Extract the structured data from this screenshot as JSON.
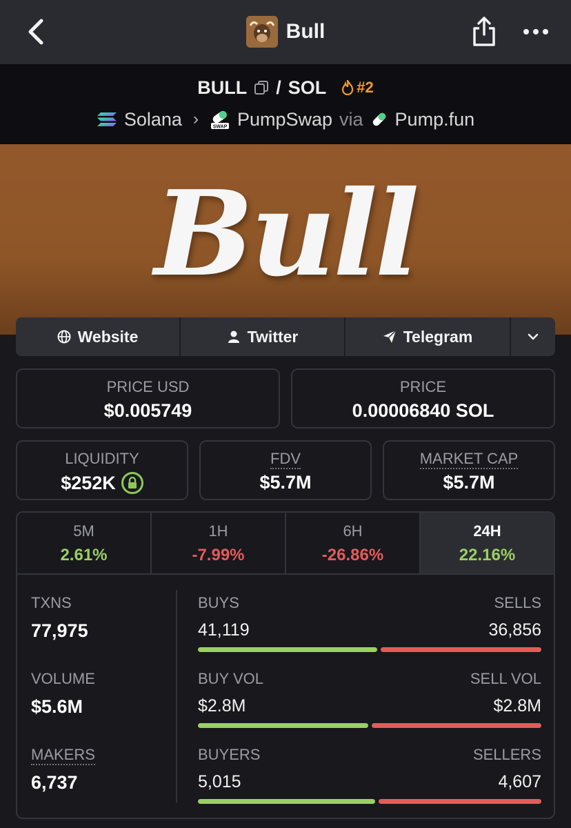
{
  "header": {
    "title": "Bull",
    "back_icon": "chevron-left-icon",
    "share_icon": "share-icon",
    "more_icon": "more-icon"
  },
  "pair": {
    "base": "BULL",
    "separator": "/",
    "quote": "SOL",
    "rank": "#2",
    "chain": "Solana",
    "dex": "PumpSwap",
    "via": "via",
    "launchpad": "Pump.fun"
  },
  "banner": {
    "logo_text": "Bull"
  },
  "links": [
    {
      "label": "Website",
      "icon": "globe-icon"
    },
    {
      "label": "Twitter",
      "icon": "user-icon"
    },
    {
      "label": "Telegram",
      "icon": "telegram-icon"
    }
  ],
  "price_usd": {
    "label": "PRICE USD",
    "value": "$0.005749"
  },
  "price_native": {
    "label": "PRICE",
    "value": "0.00006840 SOL"
  },
  "liquidity": {
    "label": "LIQUIDITY",
    "value": "$252K"
  },
  "fdv": {
    "label": "FDV",
    "value": "$5.7M"
  },
  "market_cap": {
    "label": "MARKET CAP",
    "value": "$5.7M"
  },
  "timeframes": [
    {
      "label": "5M",
      "change": "2.61%",
      "direction": "up"
    },
    {
      "label": "1H",
      "change": "-7.99%",
      "direction": "down"
    },
    {
      "label": "6H",
      "change": "-26.86%",
      "direction": "down"
    },
    {
      "label": "24H",
      "change": "22.16%",
      "direction": "up",
      "active": true
    }
  ],
  "stats": {
    "txns": {
      "label": "TXNS",
      "value": "77,975"
    },
    "volume": {
      "label": "VOLUME",
      "value": "$5.6M"
    },
    "makers": {
      "label": "MAKERS",
      "value": "6,737"
    },
    "buys": {
      "label": "BUYS",
      "value": "41,119",
      "share": 0.527
    },
    "sells": {
      "label": "SELLS",
      "value": "36,856"
    },
    "buy_vol": {
      "label": "BUY VOL",
      "value": "$2.8M",
      "share": 0.5
    },
    "sell_vol": {
      "label": "SELL VOL",
      "value": "$2.8M"
    },
    "buyers": {
      "label": "BUYERS",
      "value": "5,015",
      "share": 0.521
    },
    "sellers": {
      "label": "SELLERS",
      "value": "4,607"
    }
  },
  "colors": {
    "positive": "#9bd062",
    "negative": "#e45b5b",
    "rank": "#f29a2c",
    "banner": "#8e5627"
  }
}
